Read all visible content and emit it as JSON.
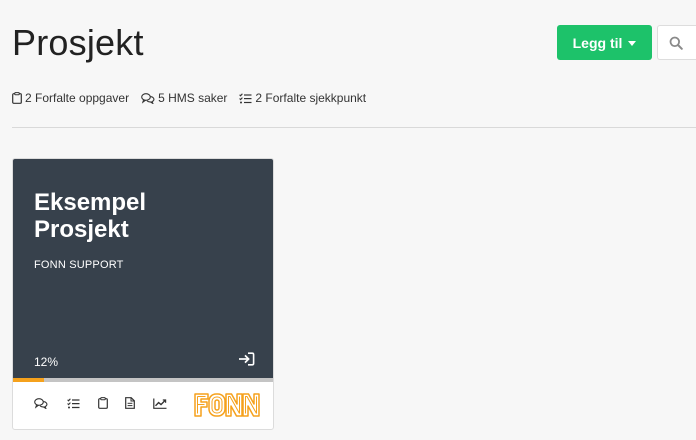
{
  "page": {
    "title": "Prosjekt"
  },
  "toolbar": {
    "add_label": "Legg til"
  },
  "summary": [
    {
      "icon": "clipboard-icon",
      "label": "2 Forfalte oppgaver"
    },
    {
      "icon": "chat-bubbles-icon",
      "label": "5 HMS saker"
    },
    {
      "icon": "checklist-icon",
      "label": "2 Forfalte sjekkpunkt"
    }
  ],
  "project_card": {
    "title": "Eksempel Prosjekt",
    "subtitle": "FONN SUPPORT",
    "progress_label": "12%",
    "progress_fraction": 0.12,
    "logo_text": "FONN",
    "colors": {
      "header_bg": "#37414c",
      "progress": "#f5a11c",
      "logo": "#f5a11c"
    },
    "actions": [
      "chat-bubbles-icon",
      "checklist-icon",
      "clipboard-icon",
      "document-icon",
      "trend-chart-icon"
    ]
  },
  "colors": {
    "accent": "#1dc26a"
  }
}
